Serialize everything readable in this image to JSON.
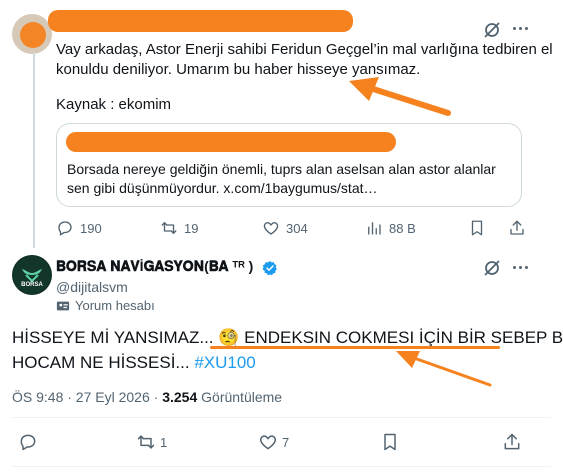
{
  "top_tweet": {
    "text_line1": "Vay arkadaş, Astor Enerji sahibi Feridun Geçgel’in mal varlığına tedbiren el",
    "text_line2": "konuldu deniliyor. Umarım bu haber hisseye yansımaz.",
    "source": "Kaynak : ekomim",
    "quote": {
      "line1": "Borsada nereye geldiğin önemli, tuprs alan aselsan alan astor alanlar",
      "line2": "sen gibi düşünmüyordur. x.com/1baygumus/stat…"
    },
    "actions": {
      "replies": "190",
      "retweets": "19",
      "likes": "304",
      "views": "88 B"
    }
  },
  "main_tweet": {
    "display_name": "𝐁𝐎𝐑𝐒𝐀 𝐍𝐀𝐕İ𝐆𝐀𝐒𝐘𝐎𝐍(𝐁𝐀 ᵀᴿ )",
    "handle": "@dijitalsvm",
    "account_label": "Yorum hesabı",
    "avatar_text": "BORSA",
    "text_part1": "HİSSEYE Mİ YANSIMAZ... ",
    "emoji": "🧐",
    "text_underlined": " ENDEKSIN COKMESI İÇİN BİR SEBEP BU",
    "text_line2": "HOCAM NE HİSSESİ... ",
    "hashtag": "#XU100",
    "time": "ÖS 9:48 · 27 Eyl 2026 · ",
    "view_count": "3.254",
    "view_label": " Görüntüleme",
    "actions": {
      "retweets": "1",
      "likes": "7"
    }
  },
  "colors": {
    "accent": "#1d9bf0",
    "annotation": "#f5821f",
    "muted": "#536471"
  }
}
